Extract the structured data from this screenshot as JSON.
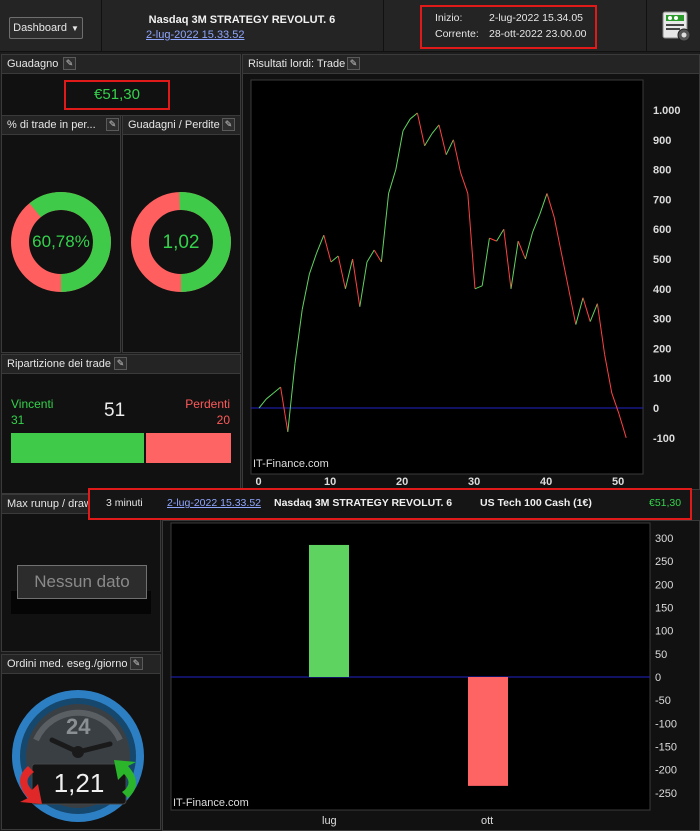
{
  "header": {
    "dashboard_label": "Dashboard",
    "strategy_name": "Nasdaq 3M STRATEGY REVOLUT. 6",
    "strategy_date": "2-lug-2022 15.33.52",
    "start_label": "Inizio:",
    "start_value": "2-lug-2022 15.34.05",
    "current_label": "Corrente:",
    "current_value": "28-ott-2022 23.00.00",
    "settings_icon": "settings-icon"
  },
  "gain": {
    "title": "Guadagno",
    "value": "€51,30"
  },
  "winrate": {
    "title": "% di trade in per...",
    "value": "60,78%",
    "fraction": 0.6078
  },
  "profit_loss": {
    "title": "Guadagni / Perdite",
    "value": "1,02",
    "fraction": 0.505
  },
  "distribution": {
    "title": "Ripartizione dei trade",
    "win_label": "Vincenti",
    "win_count": "31",
    "total": "51",
    "loss_label": "Perdenti",
    "loss_count": "20"
  },
  "runup": {
    "title": "Max runup / draw",
    "nodata": "Nessun dato"
  },
  "orders": {
    "title": "Ordini med. eseg./giorno",
    "value": "1,21",
    "dial": "24"
  },
  "info_strip": {
    "timeframe": "3 minuti",
    "date": "2-lug-2022 15.33.52",
    "strategy": "Nasdaq 3M STRATEGY REVOLUT. 6",
    "instrument": "US Tech 100 Cash (1€)",
    "value": "€51,30"
  },
  "trade_chart_panel": {
    "title": "Risultati lordi: Trade",
    "watermark": "IT-Finance.com"
  },
  "monthly_chart_panel": {
    "watermark": "IT-Finance.com"
  },
  "colors": {
    "up": "#5fd35f",
    "down": "#ff4040",
    "zero_line": "#2323c8",
    "win": "#3fca4a",
    "loss": "#ff6464"
  },
  "chart_data": [
    {
      "type": "line",
      "x_ticks": [
        "0",
        "10",
        "20",
        "30",
        "40",
        "50"
      ],
      "y_ticks": [
        "-100",
        "0",
        "100",
        "200",
        "300",
        "400",
        "500",
        "600",
        "700",
        "800",
        "900",
        "1.000"
      ],
      "xlim": [
        0,
        54
      ],
      "ylim": [
        -160,
        1100
      ],
      "x": [
        0,
        1,
        2,
        3,
        4,
        5,
        6,
        7,
        8,
        9,
        10,
        11,
        12,
        13,
        14,
        15,
        16,
        17,
        18,
        19,
        20,
        21,
        22,
        23,
        24,
        25,
        26,
        27,
        28,
        29,
        30,
        31,
        32,
        33,
        34,
        35,
        36,
        37,
        38,
        39,
        40,
        41,
        42,
        43,
        44,
        45,
        46,
        47,
        48,
        49,
        50,
        51
      ],
      "y": [
        0,
        30,
        50,
        70,
        -80,
        150,
        330,
        450,
        520,
        580,
        490,
        510,
        400,
        500,
        340,
        490,
        530,
        490,
        720,
        800,
        930,
        970,
        990,
        880,
        920,
        950,
        850,
        900,
        790,
        720,
        400,
        410,
        570,
        560,
        600,
        400,
        560,
        500,
        590,
        650,
        720,
        640,
        520,
        400,
        280,
        370,
        290,
        350,
        180,
        50,
        -20,
        -100
      ]
    },
    {
      "type": "bar",
      "categories": [
        "lug",
        "ott"
      ],
      "values": [
        285,
        -235
      ],
      "y_ticks": [
        "300",
        "250",
        "200",
        "150",
        "100",
        "50",
        "0",
        "-50",
        "-100",
        "-150",
        "-200",
        "-250"
      ],
      "ylim": [
        -265,
        315
      ]
    }
  ]
}
